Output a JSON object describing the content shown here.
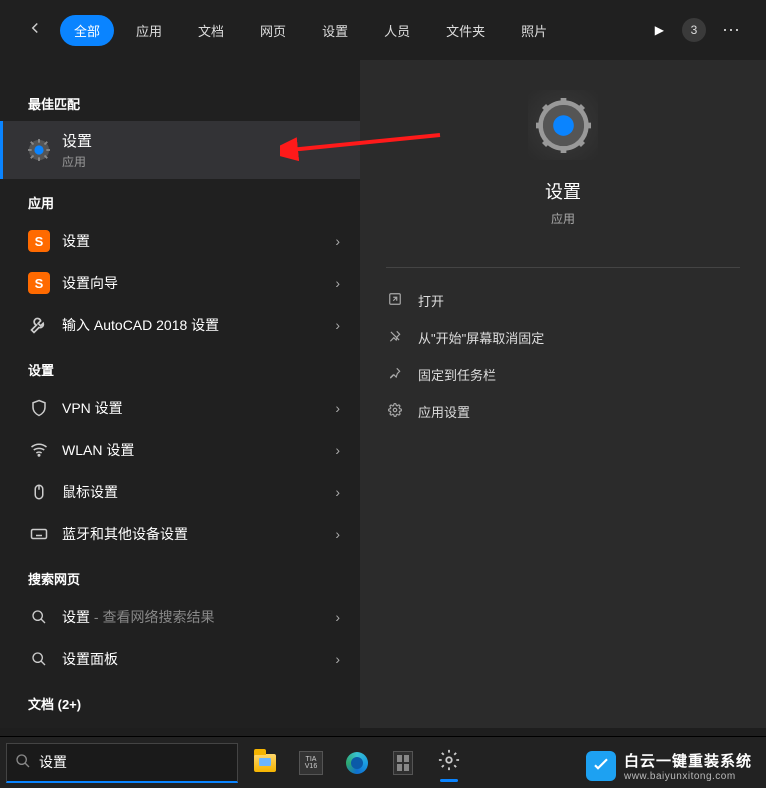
{
  "topbar": {
    "tabs": [
      "全部",
      "应用",
      "文档",
      "网页",
      "设置",
      "人员",
      "文件夹",
      "照片"
    ],
    "active_index": 0,
    "count_badge": "3"
  },
  "left": {
    "best_match_header": "最佳匹配",
    "best_match": {
      "title": "设置",
      "subtitle": "应用"
    },
    "apps_header": "应用",
    "apps": [
      {
        "label": "设置",
        "icon": "sogou"
      },
      {
        "label": "设置向导",
        "icon": "sogou"
      },
      {
        "label": "输入 AutoCAD 2018 设置",
        "icon": "wrench"
      }
    ],
    "settings_header": "设置",
    "settings": [
      {
        "label": "VPN 设置",
        "icon": "shield"
      },
      {
        "label": "WLAN 设置",
        "icon": "wifi"
      },
      {
        "label": "鼠标设置",
        "icon": "mouse"
      },
      {
        "label": "蓝牙和其他设备设置",
        "icon": "keyboard"
      }
    ],
    "web_header": "搜索网页",
    "web": [
      {
        "label": "设置",
        "suffix": " - 查看网络搜索结果",
        "icon": "search"
      },
      {
        "label": "设置面板",
        "icon": "search"
      }
    ],
    "docs_header": "文档 (2+)"
  },
  "right": {
    "title": "设置",
    "subtitle": "应用",
    "actions": [
      {
        "label": "打开",
        "icon": "open"
      },
      {
        "label": "从\"开始\"屏幕取消固定",
        "icon": "unpin"
      },
      {
        "label": "固定到任务栏",
        "icon": "pin"
      },
      {
        "label": "应用设置",
        "icon": "gear"
      }
    ]
  },
  "taskbar": {
    "search_value": "设置",
    "tia_top": "TIA",
    "tia_bottom": "V16"
  },
  "watermark": {
    "line1": "白云一键重装系统",
    "line2": "www.baiyunxitong.com"
  }
}
